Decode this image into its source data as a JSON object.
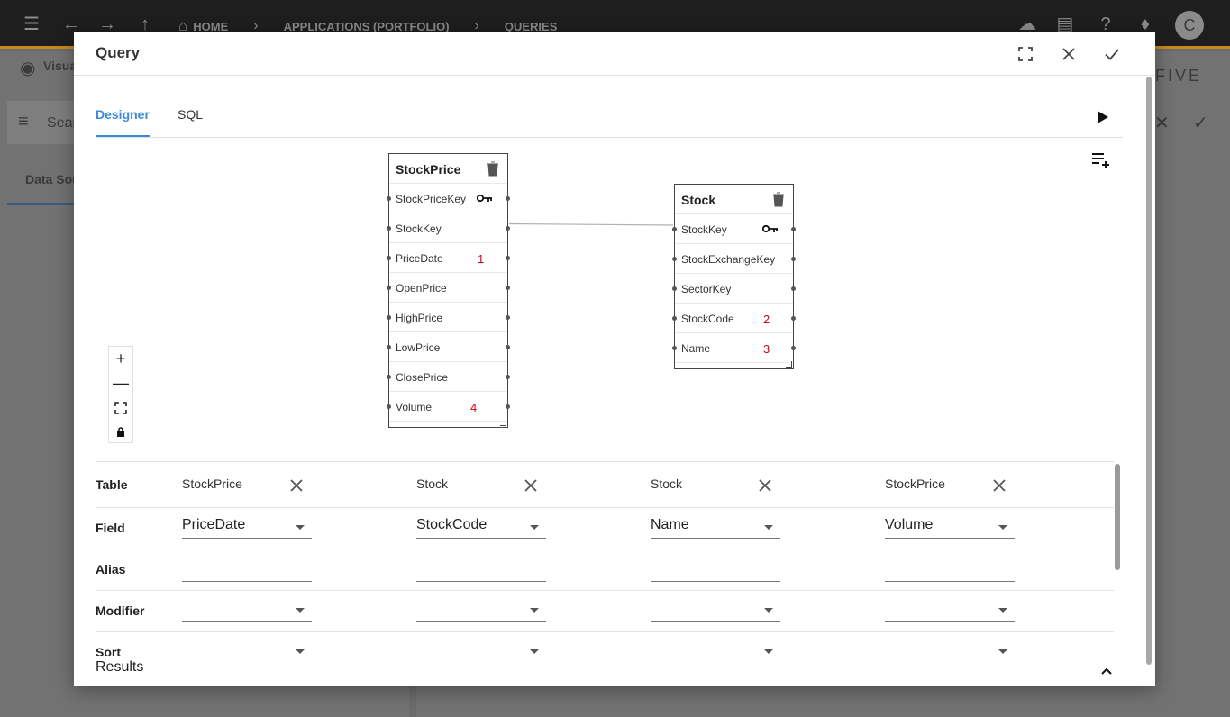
{
  "app": {
    "breadcrumbs": [
      "HOME",
      "APPLICATIONS (PORTFOLIO)",
      "QUERIES"
    ],
    "avatar_letter": "C",
    "bg_view_label": "Visua",
    "bg_search_placeholder": "Sear",
    "bg_tab_label": "Data Sou",
    "bg_logo": "FIVE"
  },
  "dialog": {
    "title": "Query",
    "tabs": [
      {
        "label": "Designer",
        "active": true
      },
      {
        "label": "SQL",
        "active": false
      }
    ]
  },
  "designer": {
    "tables": [
      {
        "name": "StockPrice",
        "fields": [
          {
            "name": "StockPriceKey",
            "key": true,
            "order": ""
          },
          {
            "name": "StockKey",
            "key": false,
            "order": ""
          },
          {
            "name": "PriceDate",
            "key": false,
            "order": "1"
          },
          {
            "name": "OpenPrice",
            "key": false,
            "order": ""
          },
          {
            "name": "HighPrice",
            "key": false,
            "order": ""
          },
          {
            "name": "LowPrice",
            "key": false,
            "order": ""
          },
          {
            "name": "ClosePrice",
            "key": false,
            "order": ""
          },
          {
            "name": "Volume",
            "key": false,
            "order": "4"
          }
        ]
      },
      {
        "name": "Stock",
        "fields": [
          {
            "name": "StockKey",
            "key": true,
            "order": ""
          },
          {
            "name": "StockExchangeKey",
            "key": false,
            "order": ""
          },
          {
            "name": "SectorKey",
            "key": false,
            "order": ""
          },
          {
            "name": "StockCode",
            "key": false,
            "order": "2"
          },
          {
            "name": "Name",
            "key": false,
            "order": "3"
          }
        ]
      }
    ],
    "join": {
      "from": "StockPrice.StockKey",
      "to": "Stock.StockKey"
    }
  },
  "grid": {
    "row_labels": {
      "table": "Table",
      "field": "Field",
      "alias": "Alias",
      "modifier": "Modifier",
      "sort": "Sort"
    },
    "columns": [
      {
        "table": "StockPrice",
        "field": "PriceDate",
        "alias": "",
        "modifier": "",
        "sort": ""
      },
      {
        "table": "Stock",
        "field": "StockCode",
        "alias": "",
        "modifier": "",
        "sort": ""
      },
      {
        "table": "Stock",
        "field": "Name",
        "alias": "",
        "modifier": "",
        "sort": ""
      },
      {
        "table": "StockPrice",
        "field": "Volume",
        "alias": "",
        "modifier": "",
        "sort": ""
      }
    ]
  },
  "results": {
    "label": "Results"
  }
}
